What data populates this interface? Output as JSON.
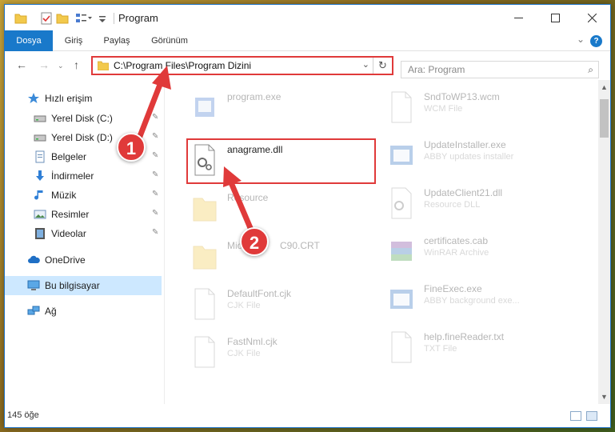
{
  "window": {
    "title": "Program"
  },
  "ribbon": {
    "tabs": [
      "Dosya",
      "Giriş",
      "Paylaş",
      "Görünüm"
    ],
    "help": "?"
  },
  "nav": {
    "address": "C:\\Program Files\\Program Dizini",
    "search_placeholder": "Ara: Program"
  },
  "sidebar": {
    "items": [
      {
        "label": "Hızlı erişim",
        "icon": "star-icon"
      },
      {
        "label": "Yerel Disk (C:)",
        "icon": "drive-icon",
        "pinned": true
      },
      {
        "label": "Yerel Disk (D:)",
        "icon": "drive-icon",
        "pinned": true
      },
      {
        "label": "Belgeler",
        "icon": "documents-icon",
        "pinned": true
      },
      {
        "label": "İndirmeler",
        "icon": "downloads-icon",
        "pinned": true
      },
      {
        "label": "Müzik",
        "icon": "music-icon",
        "pinned": true
      },
      {
        "label": "Resimler",
        "icon": "pictures-icon",
        "pinned": true
      },
      {
        "label": "Videolar",
        "icon": "videos-icon",
        "pinned": true
      },
      {
        "label": "OneDrive",
        "icon": "cloud-icon"
      },
      {
        "label": "Bu bilgisayar",
        "icon": "computer-icon",
        "selected": true
      },
      {
        "label": "Ağ",
        "icon": "network-icon"
      }
    ]
  },
  "files": {
    "left": [
      {
        "name": "program.exe",
        "type": ""
      },
      {
        "name": "anagrame.dll",
        "type": ""
      },
      {
        "name": "Resource",
        "type": ""
      },
      {
        "name": "Micro",
        "name_tail": "C90.CRT",
        "type": ""
      },
      {
        "name": "DefaultFont.cjk",
        "type": "CJK File"
      },
      {
        "name": "FastNml.cjk",
        "type": "CJK File"
      }
    ],
    "right": [
      {
        "name": "SndToWP13.wcm",
        "type": "WCM File"
      },
      {
        "name": "UpdateInstaller.exe",
        "type": "ABBY updates installer"
      },
      {
        "name": "UpdateClient21.dll",
        "type": "Resource DLL"
      },
      {
        "name": "certificates.cab",
        "type": "WinRAR Archive"
      },
      {
        "name": "FineExec.exe",
        "type": "ABBY background exe..."
      },
      {
        "name": "help.fineReader.txt",
        "type": "TXT File"
      }
    ]
  },
  "status": {
    "count": "145 öğe"
  },
  "annotations": {
    "step1": "1",
    "step2": "2"
  },
  "colors": {
    "accent": "#1979ca",
    "annotation": "#e03a3a",
    "selected": "#cde8ff"
  }
}
